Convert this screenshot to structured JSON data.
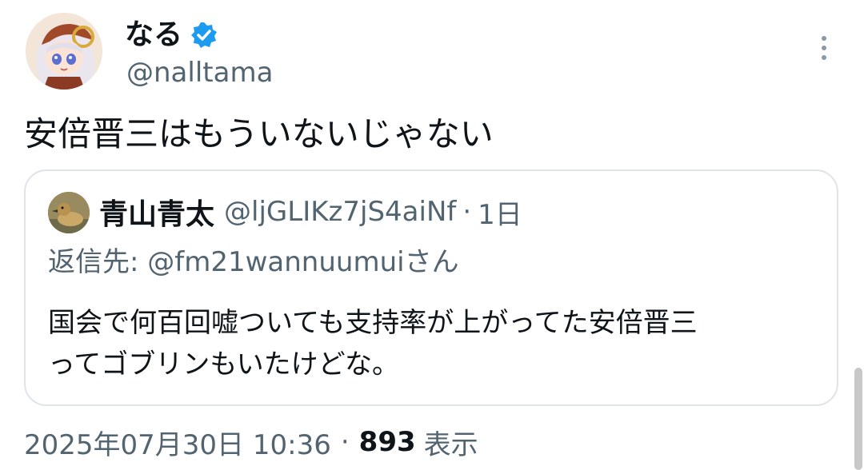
{
  "author": {
    "display_name": "なる",
    "handle": "@nalltama",
    "verified_icon": "verified-badge-icon",
    "verified_color": "#1d9bf0",
    "avatar_icon": "anime-character-avatar"
  },
  "tweet": {
    "text": "安倍晋三はもういないじゃない"
  },
  "more_icon": "more-vertical-icon",
  "quote": {
    "author_name": "青山青太",
    "author_handle": "@ljGLIKz7jS4aiNf",
    "separator": "·",
    "time": "1日",
    "reply_to": "返信先: @fm21wannuumuiさん",
    "body_line1": "国会で何百回嘘ついても支持率が上がってた安倍晋三",
    "body_line2": "ってゴブリンもいたけどな。",
    "avatar_icon": "duck-photo-avatar"
  },
  "meta": {
    "timestamp": "2025年07月30日 10:36",
    "separator": "·",
    "views_count": "893",
    "views_label": "表示"
  },
  "colors": {
    "text_primary": "#0f1419",
    "text_secondary": "#536471",
    "border": "#dfe4e8"
  }
}
